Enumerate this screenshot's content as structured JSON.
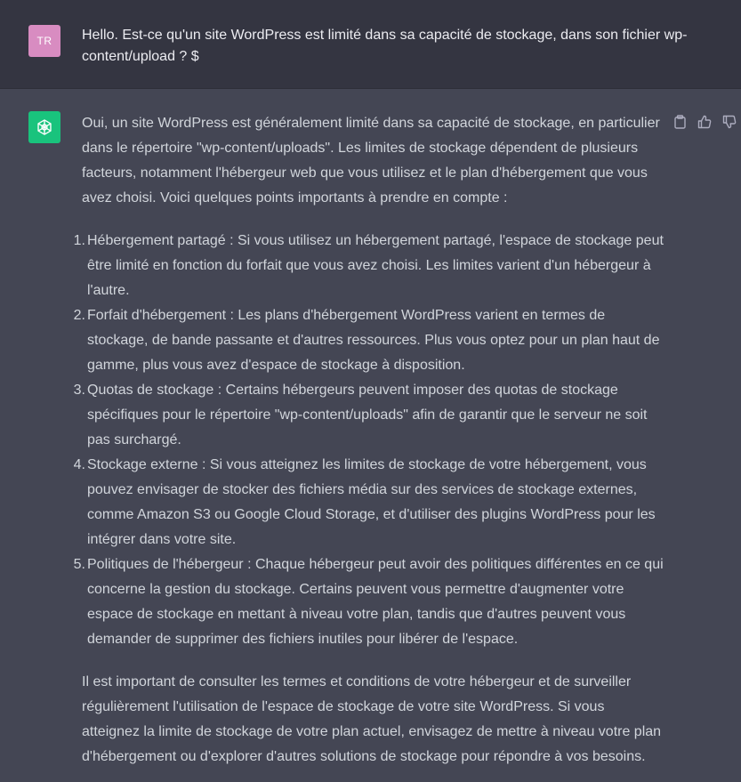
{
  "user": {
    "initials": "TR",
    "message": "Hello. Est-ce qu'un site WordPress est limité dans sa capacité de stockage, dans son fichier wp-content/upload ? $"
  },
  "assistant": {
    "intro": "Oui, un site WordPress est généralement limité dans sa capacité de stockage, en particulier dans le répertoire \"wp-content/uploads\". Les limites de stockage dépendent de plusieurs facteurs, notamment l'hébergeur web que vous utilisez et le plan d'hébergement que vous avez choisi. Voici quelques points importants à prendre en compte :",
    "points": [
      {
        "num": "1.",
        "text": "Hébergement partagé : Si vous utilisez un hébergement partagé, l'espace de stockage peut être limité en fonction du forfait que vous avez choisi. Les limites varient d'un hébergeur à l'autre."
      },
      {
        "num": "2.",
        "text": "Forfait d'hébergement : Les plans d'hébergement WordPress varient en termes de stockage, de bande passante et d'autres ressources. Plus vous optez pour un plan haut de gamme, plus vous avez d'espace de stockage à disposition."
      },
      {
        "num": "3.",
        "text": "Quotas de stockage : Certains hébergeurs peuvent imposer des quotas de stockage spécifiques pour le répertoire \"wp-content/uploads\" afin de garantir que le serveur ne soit pas surchargé."
      },
      {
        "num": "4.",
        "text": "Stockage externe : Si vous atteignez les limites de stockage de votre hébergement, vous pouvez envisager de stocker des fichiers média sur des services de stockage externes, comme Amazon S3 ou Google Cloud Storage, et d'utiliser des plugins WordPress pour les intégrer dans votre site."
      },
      {
        "num": "5.",
        "text": "Politiques de l'hébergeur : Chaque hébergeur peut avoir des politiques différentes en ce qui concerne la gestion du stockage. Certains peuvent vous permettre d'augmenter votre espace de stockage en mettant à niveau votre plan, tandis que d'autres peuvent vous demander de supprimer des fichiers inutiles pour libérer de l'espace."
      }
    ],
    "outro": "Il est important de consulter les termes et conditions de votre hébergeur et de surveiller régulièrement l'utilisation de l'espace de stockage de votre site WordPress. Si vous atteignez la limite de stockage de votre plan actuel, envisagez de mettre à niveau votre plan d'hébergement ou d'explorer d'autres solutions de stockage pour répondre à vos besoins.",
    "actions": [
      {
        "icon": "clipboard-icon"
      },
      {
        "icon": "thumbs-up-icon"
      },
      {
        "icon": "thumbs-down-icon"
      }
    ]
  },
  "colors": {
    "user_bg": "#343541",
    "assistant_bg": "#444654",
    "user_avatar": "#d88cc1",
    "bot_avatar": "#19c37d",
    "text": "#d1d5db"
  }
}
